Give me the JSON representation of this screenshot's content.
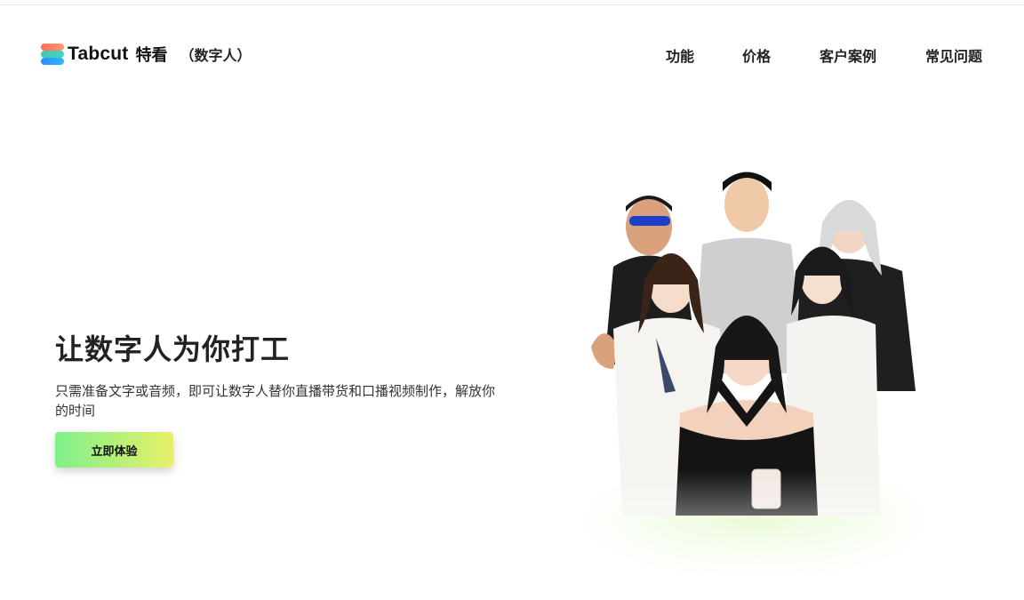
{
  "header": {
    "brand": "Tabcut",
    "brand_cn": "特看",
    "product": "（数字人）",
    "nav": [
      {
        "label": "功能"
      },
      {
        "label": "价格"
      },
      {
        "label": "客户案例"
      },
      {
        "label": "常见问题"
      }
    ]
  },
  "hero": {
    "title": "让数字人为你打工",
    "description": "只需准备文字或音频，即可让数字人替你直播带货和口播视频制作，解放你的时间",
    "cta_label": "立即体验"
  },
  "colors": {
    "cta_start": "#7ef08a",
    "cta_end": "#e8f06a",
    "text": "#222222"
  },
  "icons": [
    "tabcut-logo-icon"
  ]
}
